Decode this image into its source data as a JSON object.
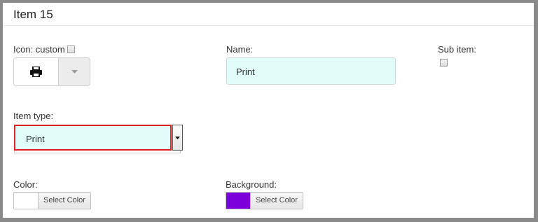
{
  "header": {
    "title": "Item 15"
  },
  "icon": {
    "label": "Icon: custom",
    "custom_checked": false,
    "selected_icon": "print-icon"
  },
  "name": {
    "label": "Name:",
    "value": "Print"
  },
  "sub_item": {
    "label": "Sub item:",
    "checked": false
  },
  "item_type": {
    "label": "Item type:",
    "value": "Print"
  },
  "color": {
    "label": "Color:",
    "button_label": "Select Color",
    "swatch": "#ffffff"
  },
  "background": {
    "label": "Background:",
    "button_label": "Select Color",
    "swatch": "#7b00d9"
  },
  "colors": {
    "input_fill": "#e0fdf9",
    "highlight_border": "#e02020"
  }
}
